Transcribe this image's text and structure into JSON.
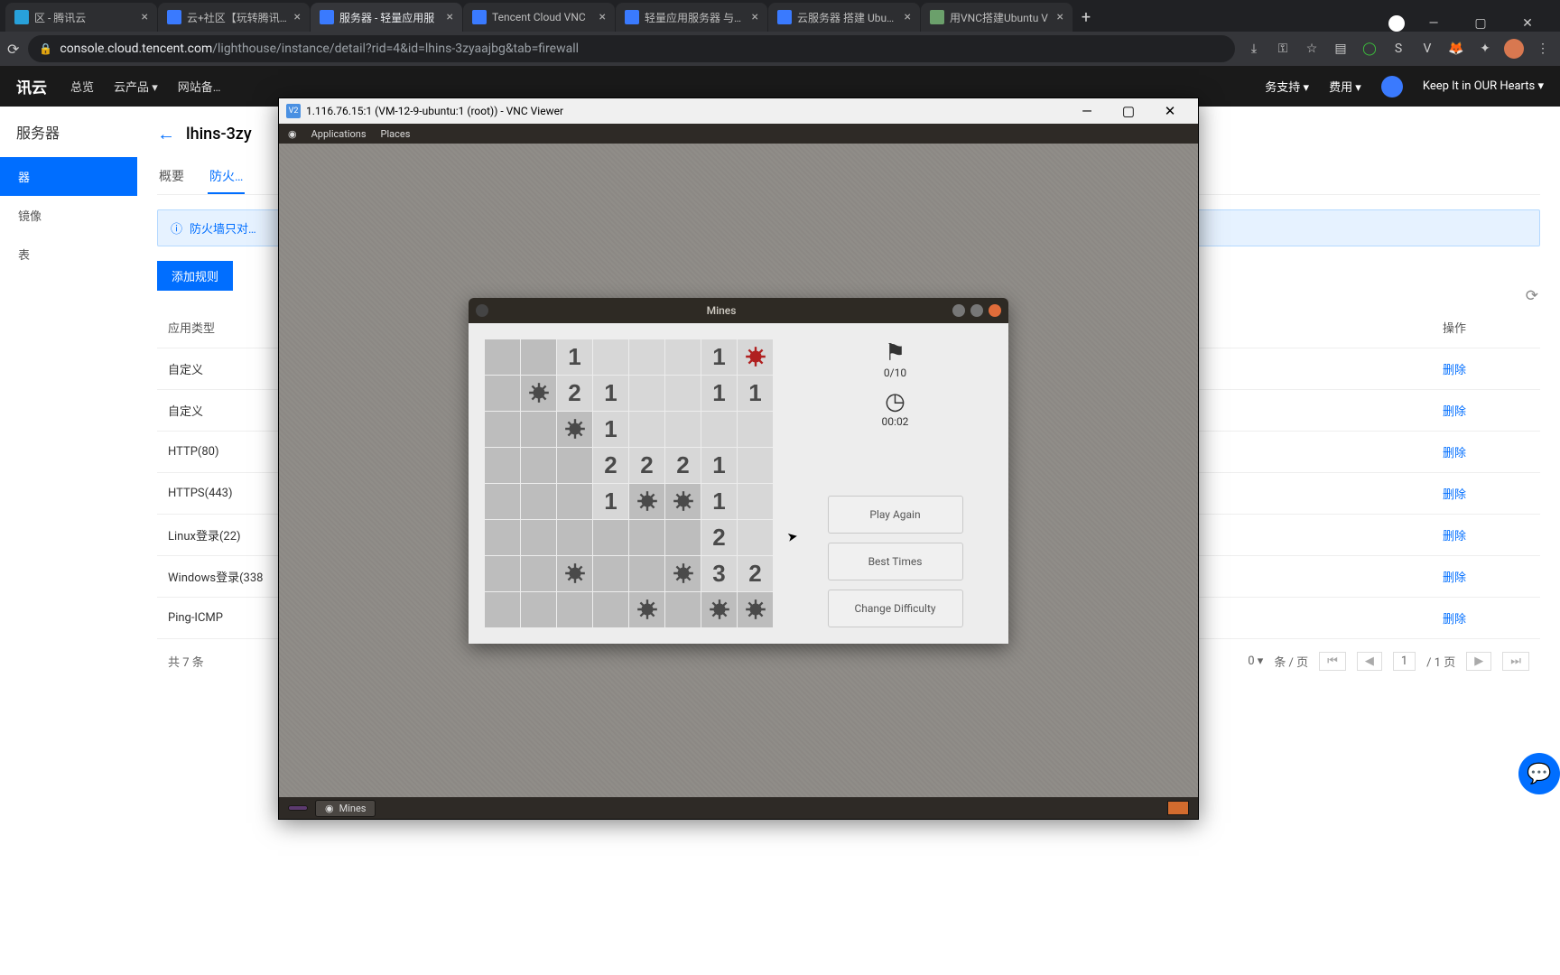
{
  "browser": {
    "tabs": [
      {
        "label": "区 - 腾讯云",
        "icon_bg": "#28a1da"
      },
      {
        "label": "云+社区【玩转腾讯…",
        "icon_bg": "#3a7afe"
      },
      {
        "label": "服务器 - 轻量应用服",
        "icon_bg": "#3a7afe"
      },
      {
        "label": "Tencent Cloud VNC",
        "icon_bg": "#3a7afe"
      },
      {
        "label": "轻量应用服务器 与…",
        "icon_bg": "#3a7afe"
      },
      {
        "label": "云服务器 搭建 Ubu…",
        "icon_bg": "#3a7afe"
      },
      {
        "label": "用VNC搭建Ubuntu V",
        "icon_bg": "#6ba06b"
      }
    ],
    "active_tab": 2,
    "url_domain": "console.cloud.tencent.com",
    "url_path": "/lighthouse/instance/detail?rid=4&id=lhins-3zyaajbg&tab=firewall"
  },
  "console": {
    "logo": "讯云",
    "nav": [
      "总览",
      "云产品 ▾",
      "网站备…"
    ],
    "right": [
      "务支持 ▾",
      "费用 ▾",
      "Keep It in OUR Hearts ▾"
    ],
    "sidebar_title": "服务器",
    "sidebar_items": [
      "器",
      "镜像",
      "表"
    ],
    "sidebar_active": 0,
    "breadcrumb_back": "←",
    "breadcrumb_title": "lhins-3zy",
    "ptabs": [
      "概要",
      "防火…"
    ],
    "ptab_active": 1,
    "info_text": "防火墙只对…",
    "add_rule": "添加规则",
    "columns": {
      "app": "应用类型",
      "op": "操作"
    },
    "rows": [
      {
        "app": "自定义",
        "op": "删除"
      },
      {
        "app": "自定义",
        "op": "删除"
      },
      {
        "app": "HTTP(80)",
        "op": "删除"
      },
      {
        "app": "HTTPS(443)",
        "op": "删除"
      },
      {
        "app": "Linux登录(22)",
        "op": "删除"
      },
      {
        "app": "Windows登录(338",
        "op": "删除"
      },
      {
        "app": "Ping-ICMP",
        "op": "删除"
      }
    ],
    "total": "共 7 条",
    "perpage": "条 / 页",
    "page_of": "/ 1 页",
    "page_num": "1",
    "pp_val": "0 ▾"
  },
  "vnc": {
    "title": "1.116.76.15:1 (VM-12-9-ubuntu:1 (root)) - VNC Viewer",
    "gnome_top": [
      "Applications",
      "Places"
    ],
    "taskbar_app": "Mines"
  },
  "mines": {
    "title": "Mines",
    "flags": "0/10",
    "time": "00:02",
    "buttons": [
      "Play Again",
      "Best Times",
      "Change Difficulty"
    ],
    "grid": [
      [
        "c",
        "c",
        "1o",
        "0o",
        "0o",
        "0o",
        "1o",
        "Mr"
      ],
      [
        "c",
        "M",
        "2o",
        "1o",
        "0o",
        "0o",
        "1o",
        "1o"
      ],
      [
        "c",
        "c",
        "M",
        "1o",
        "0o",
        "0o",
        "0o",
        "0o"
      ],
      [
        "c",
        "c",
        "c",
        "2o",
        "2o",
        "2o",
        "1o",
        "0o"
      ],
      [
        "c",
        "c",
        "c",
        "1o",
        "M",
        "M",
        "1o",
        "0o"
      ],
      [
        "c",
        "c",
        "c",
        "c",
        "c",
        "c",
        "2o",
        "0o"
      ],
      [
        "c",
        "c",
        "M",
        "c",
        "c",
        "M",
        "3o",
        "2o"
      ],
      [
        "c",
        "c",
        "c",
        "c",
        "M",
        "c",
        "M",
        "M"
      ]
    ]
  }
}
